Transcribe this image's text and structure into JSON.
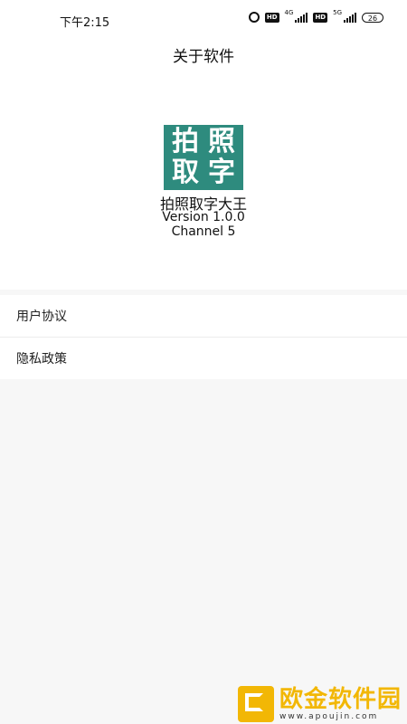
{
  "status_bar": {
    "time": "下午2:15",
    "network_1": "4G",
    "network_2": "5G",
    "hd_label": "HD",
    "battery": "26"
  },
  "header": {
    "title": "关于软件"
  },
  "app": {
    "logo_chars": [
      "拍",
      "照",
      "取",
      "字"
    ],
    "name": "拍照取字大王",
    "version": "Version 1.0.0",
    "channel": "Channel 5",
    "logo_color": "#2e8b7e"
  },
  "menu": {
    "items": [
      {
        "label": "用户协议"
      },
      {
        "label": "隐私政策"
      }
    ]
  },
  "watermark": {
    "title": "欧金软件园",
    "url": "www.apoujin.com",
    "color": "#f2b705"
  }
}
